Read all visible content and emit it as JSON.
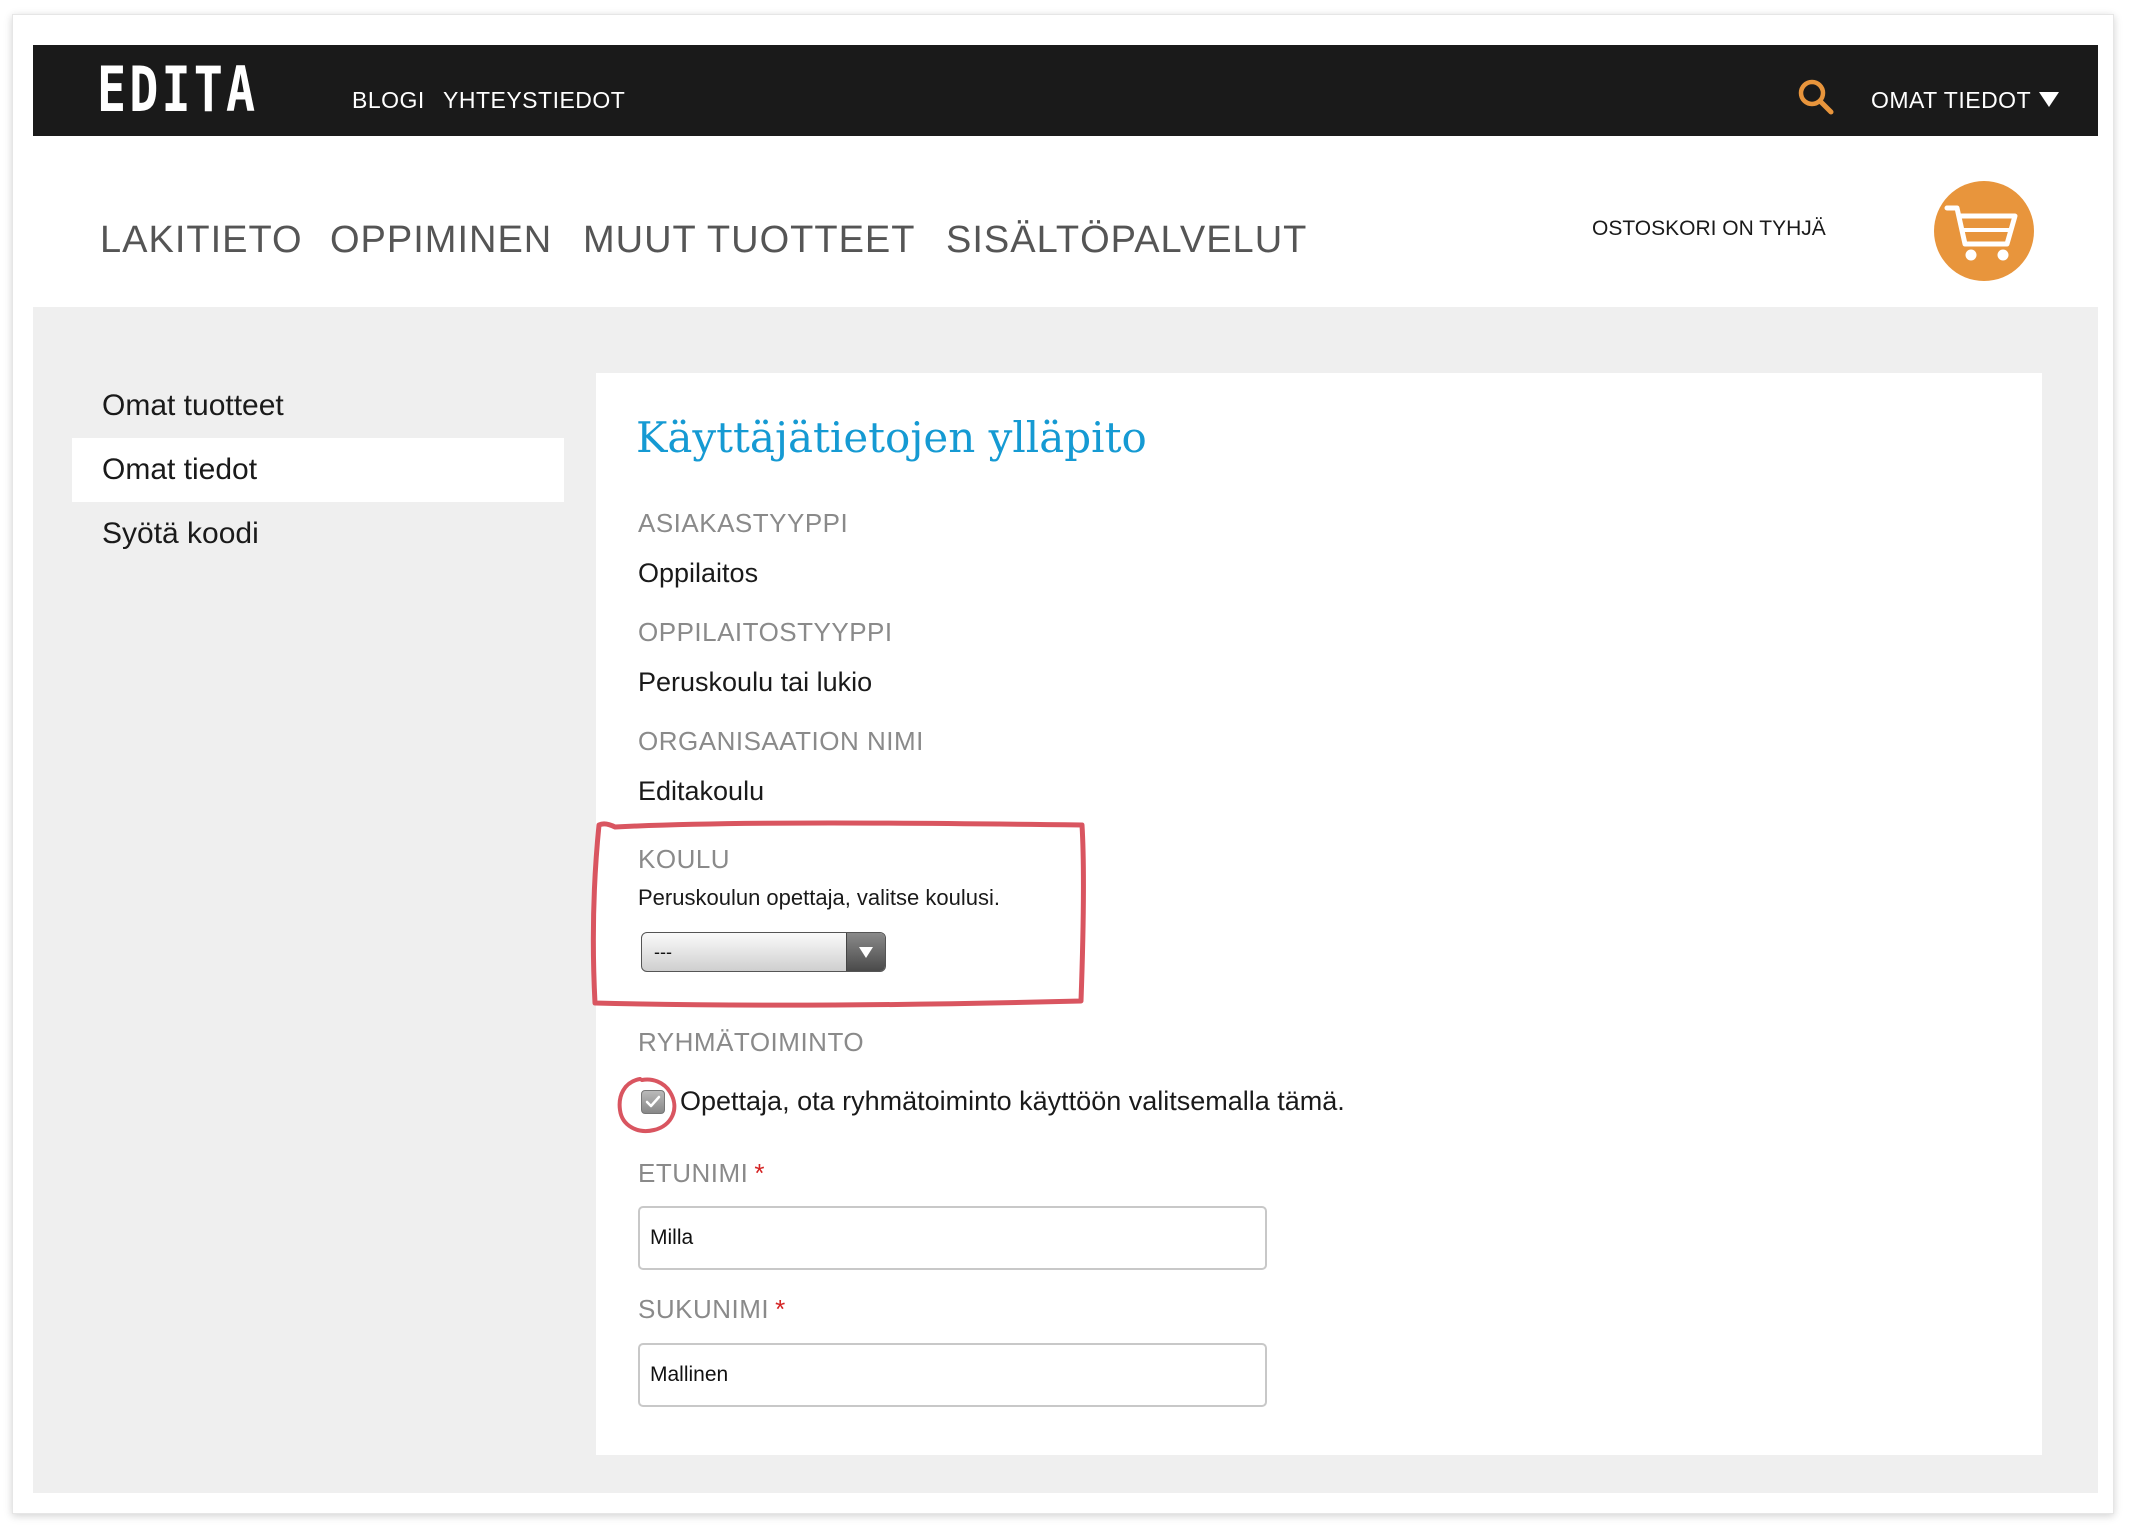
{
  "header": {
    "logo": "EDITA",
    "nav": [
      "BLOGI",
      "YHTEYSTIEDOT"
    ],
    "account_label": "OMAT TIEDOT"
  },
  "main_nav": [
    "LAKITIETO",
    "OPPIMINEN",
    "MUUT TUOTTEET",
    "SISÄLTÖPALVELUT"
  ],
  "cart": {
    "status": "OSTOSKORI ON TYHJÄ"
  },
  "sidebar": {
    "items": [
      {
        "label": "Omat tuotteet"
      },
      {
        "label": "Omat tiedot"
      },
      {
        "label": "Syötä koodi"
      }
    ]
  },
  "form": {
    "title": "Käyttäjätietojen ylläpito",
    "asiakastyyppi": {
      "label": "ASIAKASTYYPPI",
      "value": "Oppilaitos"
    },
    "oppilaitostyyppi": {
      "label": "OPPILAITOSTYYPPI",
      "value": "Peruskoulu tai lukio"
    },
    "organisaatio": {
      "label": "ORGANISAATION NIMI",
      "value": "Editakoulu"
    },
    "koulu": {
      "label": "KOULU",
      "hint": "Peruskoulun opettaja, valitse koulusi.",
      "selected": "---"
    },
    "ryhmatoiminto": {
      "label": "RYHMÄTOIMINTO",
      "checkbox_label": "Opettaja, ota ryhmätoiminto käyttöön valitsemalla tämä.",
      "checked": true
    },
    "etunimi": {
      "label": "ETUNIMI",
      "value": "Milla"
    },
    "sukunimi": {
      "label": "SUKUNIMI",
      "value": "Mallinen"
    },
    "required_mark": "*"
  },
  "colors": {
    "accent_orange": "#e8953c",
    "title_blue": "#159ad3",
    "annotation_red": "#d95560",
    "topbar": "#1a1a1a"
  }
}
